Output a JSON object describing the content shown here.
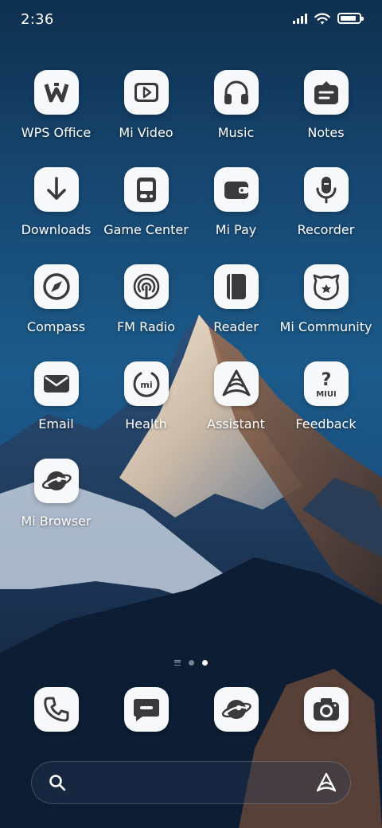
{
  "status_bar": {
    "time": "2:36",
    "signal_icon": "cellular-signal-icon",
    "wifi_icon": "wifi-icon",
    "battery_icon": "battery-icon",
    "battery_level": 0.9
  },
  "apps": [
    {
      "label": "WPS Office",
      "icon": "wps-office-icon"
    },
    {
      "label": "Mi Video",
      "icon": "play-video-icon"
    },
    {
      "label": "Music",
      "icon": "headphones-icon"
    },
    {
      "label": "Notes",
      "icon": "notes-icon"
    },
    {
      "label": "Downloads",
      "icon": "download-arrow-icon"
    },
    {
      "label": "Game Center",
      "icon": "gamepad-icon"
    },
    {
      "label": "Mi Pay",
      "icon": "wallet-icon"
    },
    {
      "label": "Recorder",
      "icon": "microphone-icon"
    },
    {
      "label": "Compass",
      "icon": "compass-icon"
    },
    {
      "label": "FM Radio",
      "icon": "radio-icon"
    },
    {
      "label": "Reader",
      "icon": "book-icon"
    },
    {
      "label": "Mi Community",
      "icon": "bunny-face-icon"
    },
    {
      "label": "Email",
      "icon": "envelope-icon"
    },
    {
      "label": "Health",
      "icon": "health-ring-icon"
    },
    {
      "label": "Assistant",
      "icon": "assistant-icon"
    },
    {
      "label": "Feedback",
      "icon": "miui-feedback-icon",
      "glyph_text": "MIUI"
    },
    {
      "label": "Mi Browser",
      "icon": "planet-browser-icon"
    }
  ],
  "page_indicator": {
    "pages": 2,
    "active": 2
  },
  "dock": [
    {
      "icon": "phone-icon"
    },
    {
      "icon": "message-icon"
    },
    {
      "icon": "planet-browser-icon"
    },
    {
      "icon": "camera-icon"
    }
  ],
  "search_bar": {
    "search_icon": "search-icon",
    "assistant_icon": "assistant-icon"
  },
  "colors": {
    "icon_bg": "#f7f8fa",
    "icon_fg": "#3a3a3c",
    "sky_top": "#0f2f4f",
    "sky_mid": "#1b5a8a"
  }
}
